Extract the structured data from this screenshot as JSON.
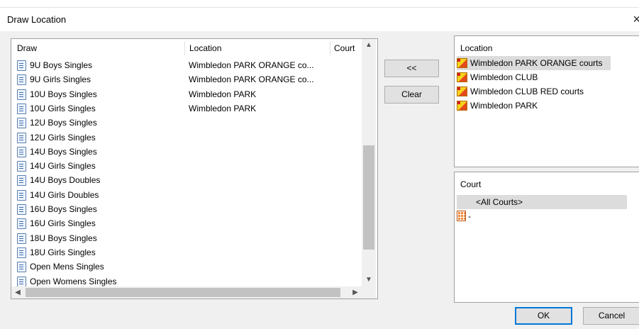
{
  "window": {
    "title": "Draw Location",
    "close_glyph": "×"
  },
  "draw_list": {
    "columns": [
      "Draw",
      "Location",
      "Court"
    ],
    "rows": [
      {
        "draw": "9U Boys Singles",
        "location": "Wimbledon PARK ORANGE co..."
      },
      {
        "draw": "9U Girls Singles",
        "location": "Wimbledon PARK ORANGE co..."
      },
      {
        "draw": "10U Boys Singles",
        "location": "Wimbledon PARK"
      },
      {
        "draw": "10U Girls Singles",
        "location": "Wimbledon PARK"
      },
      {
        "draw": "12U Boys Singles",
        "location": ""
      },
      {
        "draw": "12U Girls Singles",
        "location": ""
      },
      {
        "draw": "14U Boys Singles",
        "location": ""
      },
      {
        "draw": "14U Girls Singles",
        "location": ""
      },
      {
        "draw": "14U Boys Doubles",
        "location": ""
      },
      {
        "draw": "14U Girls Doubles",
        "location": ""
      },
      {
        "draw": "16U Boys Singles",
        "location": ""
      },
      {
        "draw": "16U Girls Singles",
        "location": ""
      },
      {
        "draw": "18U Boys Singles",
        "location": ""
      },
      {
        "draw": "18U Girls Singles",
        "location": ""
      },
      {
        "draw": "Open Mens Singles",
        "location": ""
      },
      {
        "draw": "Open Womens Singles",
        "location": ""
      }
    ],
    "icon": "draw-document-icon"
  },
  "buttons": {
    "assign": "<<",
    "clear": "Clear",
    "ok": "OK",
    "cancel": "Cancel"
  },
  "location_panel": {
    "header": "Location",
    "items": [
      "Wimbledon PARK ORANGE courts",
      "Wimbledon CLUB",
      "Wimbledon CLUB RED courts",
      "Wimbledon PARK"
    ],
    "selected_index": 0,
    "icon": "location-icon"
  },
  "court_panel": {
    "header": "Court",
    "items": [
      "<All Courts>",
      "-"
    ],
    "selected_index": 0,
    "icon": "court-icon"
  },
  "colors": {
    "dialog_bg": "#f0f0f0",
    "selection": "#dcdcdc",
    "ok_border": "#0078d7"
  }
}
